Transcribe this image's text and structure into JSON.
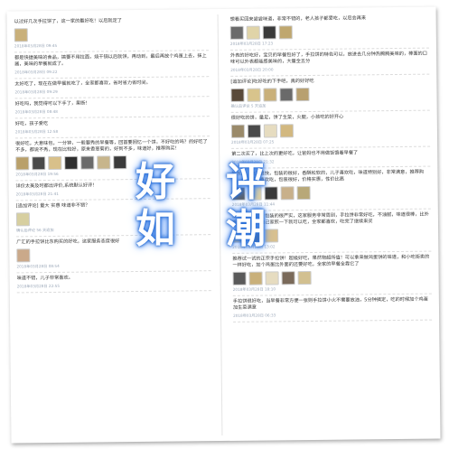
{
  "overlay_text": [
    "好",
    "评",
    "如",
    "潮"
  ],
  "left_reviews": [
    {
      "text": "以过好几次手拉饼了，这一家的最好吃！以后就定了",
      "date": "2018年03月28日 09:45",
      "thumbs": [
        "#c9b07a"
      ]
    },
    {
      "text": "都是快捷美味的食品，搞要不用拉面，烧干锅以后就饼，再动到，最后再放个鸡蛋上去，抹上酱，美味的早餐就成了。",
      "date": "2018年03月28日 09:22",
      "thumbs": []
    },
    {
      "text": "太好吃了，现在在做早餐就吃了，全家都喜欢，省时省力省时间。",
      "date": "2018年03月28日 09:29",
      "thumbs": []
    },
    {
      "text": "好吃吗，我觉得可以下手了，果断！",
      "date": "2018年03月28日 08:48",
      "thumbs": []
    },
    {
      "text": "好吃，孩子爱吃",
      "date": "2018年03月28日 12:58",
      "thumbs": []
    },
    {
      "text": "很好吃，大意味包，一分钟，一般要秀的早餐等，回首要回忆一个饼，不好吃的吗？的好吃了不多，都说不秀，现在比较好，原来香葱菊的，好到不多，味道好，推荐购买！",
      "date": "2018年03月28日 19:56",
      "thumbs": [
        "#b9a06a",
        "#4a4a4a",
        "#d8c08a",
        "#2f2f2f",
        "#6b6b6b",
        "#c7b58c",
        "#3b3b3b"
      ]
    },
    {
      "text": "详价太美及时都出评价,系统默认好评！",
      "date": "2018年03月28日 21:41",
      "thumbs": []
    },
    {
      "text": "[追加评论] 量大 实惠 味道非不错？",
      "date": "确认后评论 56 天追加",
      "thumbs": [
        "#d7cfa0"
      ]
    },
    {
      "text": "广汇的手拉饼比东购买的好吃，这家服务态度很好",
      "date": "2018年03月28日 08:54",
      "thumbs": [
        "#caa98a"
      ]
    },
    {
      "text": "味道不错，儿子非常喜欢。",
      "date": "2018年03月28日 22:55",
      "thumbs": []
    }
  ],
  "right_reviews": [
    {
      "text": "想看买回来尝尝味道，非常不错的，老人孩子都爱吃，以后会再来",
      "date": "2018年03月28日 17:23",
      "thumbs": [
        "#6b6b6b",
        "#e0d4a8",
        "#3a3a3a",
        "#bfa76f"
      ]
    },
    {
      "text": "外表的好吃好，宝贝的早餐包好了，手拉饼的特色可以，放进去几分钟热腾腾美味的，棒面的口味可以外表都能感美味的，大量全五分",
      "date": "2018年03月28日 20:00",
      "thumbs": []
    },
    {
      "text": "[追加评论]吃好吃的下手吧，真的好好吃",
      "date": "确认后评论 5 天追加",
      "thumbs": [
        "#5a4a3a",
        "#d8c48c",
        "#c9b07a",
        "#6a6a6a",
        "#b8a070"
      ]
    },
    {
      "text": "很好吃的饼，量足，饼了生菜，火腿，小孩吃的好开心",
      "date": "2018年03月28日 07:25",
      "thumbs": [
        "#9a8a6a",
        "#4a4a4a",
        "#e6dcc0",
        "#d2b880"
      ]
    },
    {
      "text": "第二次买了，比上次的更好吃，让爸妈也不用做饭饿着早餐了",
      "date": "2018年03月28日 21:32",
      "thumbs": []
    },
    {
      "text": "好东西，物流很快，包装的很好，香酥松软的，儿子喜欢吃，味道特别好，非常满意，推荐购买，全家都很喜欢吃，包装很好，价格实惠，性价比高",
      "date": "2018年03月28日 11:44",
      "thumbs": [
        "#5a5a5a",
        "#e0d0a0",
        "#3a3a3a",
        "#c8b08a",
        "#b8a878"
      ]
    },
    {
      "text": "宝贝已经收到，包装的很严实，这家服务非常周到，手拉饼非常好吃，不油腻，味道很棒，比外面买的要好，自己家煎一下就可以吃，全家都喜欢，吃完了继续来买",
      "date": "2018年03月28日 13:02",
      "thumbs": [
        "#c9b07a",
        "#4a4a4a",
        "#d8c090"
      ]
    },
    {
      "text": "推荐试一试的正宗手拉饼！超级好吃，果然物超所值！可以拿来做鸡蛋饼的味道，和小吃街卖的一样好吃，加个鸡蛋比外面的还要好吃，全家的早餐全靠它了",
      "date": "2018年03月28日 18:10",
      "thumbs": [
        "#5a5a5a",
        "#c9b07a",
        "#e6dcc0",
        "#7a6a5a",
        "#d2c090"
      ]
    },
    {
      "text": "手拉饼很好吃，当早餐非常方便一张则手拉饼小火不需要放油，5分钟搞定，吃的时候加个鸡蛋加生菜满意",
      "date": "2018年03月28日 06:33",
      "thumbs": []
    }
  ]
}
